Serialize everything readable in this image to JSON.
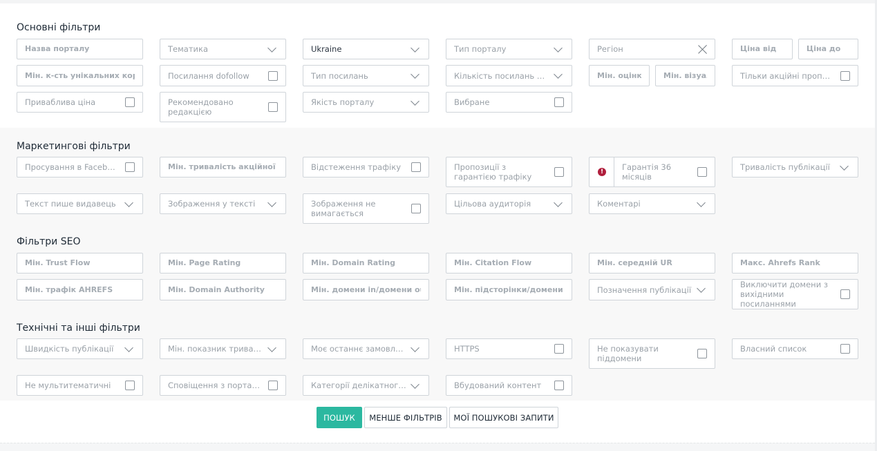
{
  "sections": {
    "basic": {
      "title": "Основні фільтри",
      "portal_name": "Назва порталу",
      "topic": "Тематика",
      "country": "Ukraine",
      "portal_type": "Тип порталу",
      "region": "Регіон",
      "price_from": "Ціна від",
      "price_to": "Ціна до",
      "min_unique_users": "Мін. к-сть унікальних користувачів",
      "dofollow_links": "Посилання dofollow",
      "link_type": "Тип посилань",
      "links_in_text": "Кількість посилань у тексті",
      "min_rating": "Мін. оцінка якості",
      "min_visual": "Мін. візуальна",
      "promo_only": "Тільки акційні пропозиції",
      "attractive_price": "Приваблива ціна",
      "editor_recommended": "Рекомендовано редакцією",
      "portal_quality": "Якість порталу",
      "favorites": "Вибране"
    },
    "marketing": {
      "title": "Маркетингові фільтри",
      "facebook_promo": "Просування в Facebook",
      "min_promo_duration": "Мін. тривалість акційної пропозиції",
      "traffic_tracking": "Відстеження трафіку",
      "traffic_guarantee": "Пропозиції з гарантією трафіку",
      "guarantee_badge": "!",
      "guarantee_36": "Гарантія 36 місяців",
      "publication_duration": "Тривалість публікації",
      "publisher_writes": "Текст пише видавець",
      "images_in_text": "Зображення у тексті",
      "image_not_required": "Зображення не вимагається",
      "target_audience": "Цільова аудиторія",
      "comments": "Коментарі"
    },
    "seo": {
      "title": "Фільтри SEO",
      "min_trust_flow": "Мін. Trust Flow",
      "min_page_rating": "Мін. Page Rating",
      "min_domain_rating": "Мін. Domain Rating",
      "min_citation_flow": "Мін. Citation Flow",
      "min_avg_ur": "Мін. середній UR",
      "max_ahrefs_rank": "Макс. Ahrefs Rank",
      "min_traffic_ahrefs": "Мін. трафік AHREFS",
      "min_domain_authority": "Мін. Domain Authority",
      "min_domains_in_out": "Мін. домени in/домени out",
      "min_subpages_out": "Мін. підсторінки/домени out",
      "publication_marking": "Позначення публікації",
      "exclude_outbound": "Виключити домени з вихідними посиланнями"
    },
    "technical": {
      "title": "Технічні та інші фільтри",
      "publication_speed": "Швидкість публікації",
      "min_duration_index": "Мін. показник тривалості",
      "my_last_order": "Моє останнє замовлення",
      "https": "HTTPS",
      "hide_subdomains": "Не показувати піддомени",
      "own_list": "Власний список",
      "not_multitopic": "Не мультитематичні",
      "portal_notifications": "Сповіщення з порталів",
      "sensitive_categories": "Категорії делікатного характеру",
      "embedded_content": "Вбудований контент"
    }
  },
  "actions": {
    "search": "ПОШУК",
    "fewer_filters": "МЕНШЕ ФІЛЬТРІВ",
    "my_searches": "МОЇ ПОШУКОВІ ЗАПИТИ"
  },
  "colors": {
    "primary": "#2bb8a0",
    "badge": "#b01e3c"
  }
}
